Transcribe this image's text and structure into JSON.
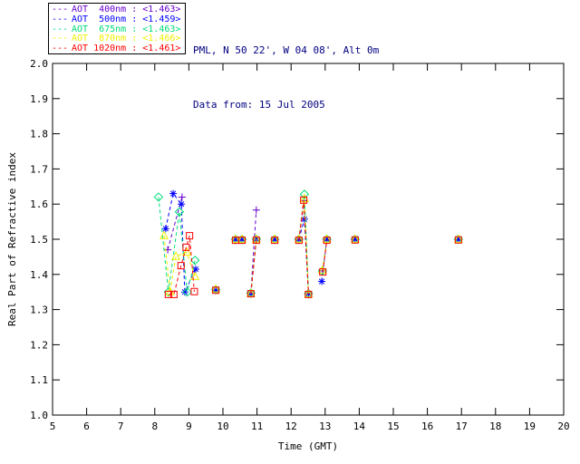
{
  "header": {
    "line1": "PML, N 50 22', W 04 08', Alt 0m",
    "line2": "Data from: 15 Jul 2005",
    "color": "#000080"
  },
  "legend": {
    "items": [
      {
        "label": "AOT  400nm",
        "value": "<1.463>",
        "color": "#6600CC"
      },
      {
        "label": "AOT  500nm",
        "value": "<1.459>",
        "color": "#0000FF"
      },
      {
        "label": "AOT  675nm",
        "value": "<1.463>",
        "color": "#00DC78"
      },
      {
        "label": "AOT  870nm",
        "value": "<1.466>",
        "color": "#F0F000"
      },
      {
        "label": "AOT 1020nm",
        "value": "<1.461>",
        "color": "#FF0000"
      }
    ]
  },
  "chart_data": {
    "type": "line",
    "title": "",
    "xlabel": "Time (GMT)",
    "ylabel": "Real Part of Refractive index",
    "xlim": [
      5,
      20
    ],
    "ylim": [
      1.0,
      2.0
    ],
    "xticks": [
      5,
      6,
      7,
      8,
      9,
      10,
      11,
      12,
      13,
      14,
      15,
      16,
      17,
      18,
      19,
      20
    ],
    "yticks": [
      1.0,
      1.1,
      1.2,
      1.3,
      1.4,
      1.5,
      1.6,
      1.7,
      1.8,
      1.9,
      2.0
    ],
    "grid": false,
    "legend_position": "top-left-outside",
    "axis_color": "#000000",
    "line_style": "dashed",
    "series": [
      {
        "name": "AOT 400nm",
        "mean": "<1.463>",
        "color": "#6600CC",
        "marker": "plus",
        "points": [
          [
            8.38,
            1.47
          ],
          [
            8.8,
            1.62
          ],
          null,
          [
            9.79,
            1.355
          ],
          null,
          [
            10.37,
            1.497
          ],
          null,
          [
            10.56,
            1.497
          ],
          null,
          [
            10.82,
            1.345
          ],
          [
            10.98,
            1.583
          ],
          null,
          [
            11.52,
            1.497
          ],
          null,
          [
            12.23,
            1.497
          ],
          [
            12.39,
            1.61
          ],
          [
            12.51,
            1.345
          ],
          null,
          [
            12.92,
            1.41
          ],
          [
            13.05,
            1.497
          ],
          null,
          [
            13.88,
            1.498
          ],
          null,
          [
            16.91,
            1.498
          ]
        ]
      },
      {
        "name": "AOT 500nm",
        "mean": "<1.459>",
        "color": "#0000FF",
        "marker": "asterisk",
        "points": [
          [
            8.32,
            1.53
          ],
          [
            8.54,
            1.63
          ],
          [
            8.78,
            1.6
          ],
          [
            8.88,
            1.35
          ],
          [
            9.2,
            1.415
          ],
          null,
          [
            9.79,
            1.355
          ],
          null,
          [
            10.37,
            1.5
          ],
          null,
          [
            10.56,
            1.5
          ],
          null,
          [
            10.82,
            1.345
          ],
          [
            10.98,
            1.5
          ],
          null,
          [
            11.52,
            1.5
          ],
          null,
          [
            12.23,
            1.5
          ],
          [
            12.39,
            1.557
          ],
          [
            12.51,
            1.345
          ],
          null,
          [
            12.9,
            1.38
          ],
          [
            13.05,
            1.5
          ],
          null,
          [
            13.88,
            1.5
          ],
          null,
          [
            16.91,
            1.5
          ]
        ]
      },
      {
        "name": "AOT 675nm",
        "mean": "<1.463>",
        "color": "#00DC78",
        "marker": "diamond",
        "points": [
          [
            8.11,
            1.62
          ],
          [
            8.4,
            1.35
          ],
          [
            8.72,
            1.578
          ],
          [
            8.95,
            1.35
          ],
          [
            9.18,
            1.44
          ],
          null,
          [
            9.79,
            1.357
          ],
          null,
          [
            10.37,
            1.5
          ],
          null,
          [
            10.56,
            1.5
          ],
          null,
          [
            10.82,
            1.347
          ],
          [
            10.98,
            1.5
          ],
          null,
          [
            11.52,
            1.5
          ],
          null,
          [
            12.23,
            1.5
          ],
          [
            12.39,
            1.628
          ],
          [
            12.51,
            1.345
          ],
          null,
          [
            12.92,
            1.41
          ],
          [
            13.05,
            1.5
          ],
          null,
          [
            13.88,
            1.5
          ],
          null,
          [
            16.91,
            1.5
          ]
        ]
      },
      {
        "name": "AOT 870nm",
        "mean": "<1.466>",
        "color": "#F0F000",
        "marker": "triangle",
        "points": [
          [
            8.27,
            1.51
          ],
          [
            8.45,
            1.35
          ],
          [
            8.62,
            1.451
          ],
          [
            8.94,
            1.463
          ],
          [
            9.18,
            1.394
          ],
          null,
          [
            9.79,
            1.358
          ],
          null,
          [
            10.37,
            1.5
          ],
          null,
          [
            10.56,
            1.5
          ],
          null,
          [
            10.82,
            1.346
          ],
          [
            10.98,
            1.5
          ],
          null,
          [
            11.52,
            1.5
          ],
          null,
          [
            12.23,
            1.5
          ],
          [
            12.39,
            1.615
          ],
          [
            12.51,
            1.344
          ],
          null,
          [
            12.92,
            1.412
          ],
          [
            13.05,
            1.5
          ],
          null,
          [
            13.88,
            1.5
          ],
          null,
          [
            16.91,
            1.5
          ]
        ]
      },
      {
        "name": "AOT 1020nm",
        "mean": "<1.461>",
        "color": "#FF0000",
        "marker": "square",
        "points": [
          [
            8.4,
            1.343
          ],
          [
            8.56,
            1.343
          ],
          [
            8.77,
            1.425
          ],
          [
            8.92,
            1.477
          ],
          [
            9.02,
            1.51
          ],
          [
            9.16,
            1.351
          ],
          null,
          [
            9.79,
            1.355
          ],
          null,
          [
            10.37,
            1.497
          ],
          null,
          [
            10.56,
            1.497
          ],
          null,
          [
            10.82,
            1.345
          ],
          [
            10.98,
            1.497
          ],
          null,
          [
            11.52,
            1.497
          ],
          null,
          [
            12.23,
            1.497
          ],
          [
            12.37,
            1.611
          ],
          [
            12.51,
            1.343
          ],
          null,
          [
            12.93,
            1.407
          ],
          [
            13.05,
            1.497
          ],
          null,
          [
            13.88,
            1.498
          ],
          null,
          [
            16.91,
            1.498
          ]
        ]
      }
    ]
  }
}
